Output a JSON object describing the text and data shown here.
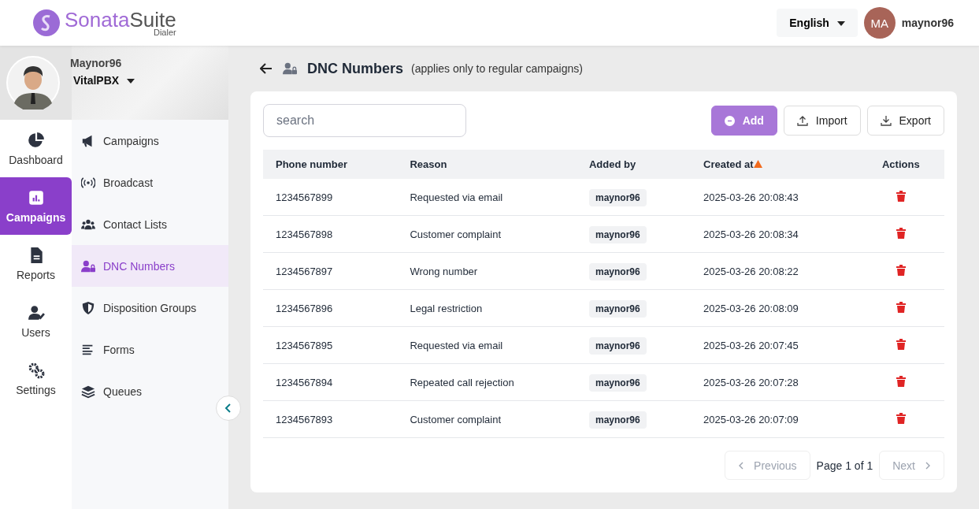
{
  "logo": {
    "word_1": "Sonata",
    "word_2": "Suite",
    "subtitle": "Dialer"
  },
  "header": {
    "language": "English",
    "avatar_initials": "MA",
    "username": "maynor96"
  },
  "profile": {
    "name": "Maynor96",
    "organization": "VitalPBX"
  },
  "rail": [
    {
      "kind": "dashboard",
      "label": "Dashboard",
      "selected": false
    },
    {
      "kind": "campaigns",
      "label": "Campaigns",
      "selected": true
    },
    {
      "kind": "reports",
      "label": "Reports",
      "selected": false
    },
    {
      "kind": "users",
      "label": "Users",
      "selected": false
    },
    {
      "kind": "settings",
      "label": "Settings",
      "selected": false
    }
  ],
  "submenu": [
    {
      "kind": "megaphone",
      "label": "Campaigns",
      "selected": false
    },
    {
      "kind": "broadcast",
      "label": "Broadcast",
      "selected": false
    },
    {
      "kind": "people",
      "label": "Contact Lists",
      "selected": false
    },
    {
      "kind": "userlock",
      "label": "DNC Numbers",
      "selected": true
    },
    {
      "kind": "shield",
      "label": "Disposition Groups",
      "selected": false
    },
    {
      "kind": "lines",
      "label": "Forms",
      "selected": false
    },
    {
      "kind": "layers",
      "label": "Queues",
      "selected": false
    }
  ],
  "page": {
    "title": "DNC Numbers",
    "note": "(applies only to regular campaigns)"
  },
  "search": {
    "placeholder": "search"
  },
  "buttons": {
    "add": "Add",
    "import": "Import",
    "export": "Export"
  },
  "table": {
    "columns": [
      "Phone number",
      "Reason",
      "Added by",
      "Created at",
      "Actions"
    ],
    "rows": [
      {
        "phone": "1234567899",
        "reason": "Requested via email",
        "added_by": "maynor96",
        "created_at": "2025-03-26 20:08:43"
      },
      {
        "phone": "1234567898",
        "reason": "Customer complaint",
        "added_by": "maynor96",
        "created_at": "2025-03-26 20:08:34"
      },
      {
        "phone": "1234567897",
        "reason": "Wrong number",
        "added_by": "maynor96",
        "created_at": "2025-03-26 20:08:22"
      },
      {
        "phone": "1234567896",
        "reason": "Legal restriction",
        "added_by": "maynor96",
        "created_at": "2025-03-26 20:08:09"
      },
      {
        "phone": "1234567895",
        "reason": "Requested via email",
        "added_by": "maynor96",
        "created_at": "2025-03-26 20:07:45"
      },
      {
        "phone": "1234567894",
        "reason": "Repeated call rejection",
        "added_by": "maynor96",
        "created_at": "2025-03-26 20:07:28"
      },
      {
        "phone": "1234567893",
        "reason": "Customer complaint",
        "added_by": "maynor96",
        "created_at": "2025-03-26 20:07:09"
      }
    ]
  },
  "pagination": {
    "previous": "Previous",
    "page_info": "Page 1 of 1",
    "next": "Next",
    "previous_disabled": true,
    "next_disabled": true
  }
}
